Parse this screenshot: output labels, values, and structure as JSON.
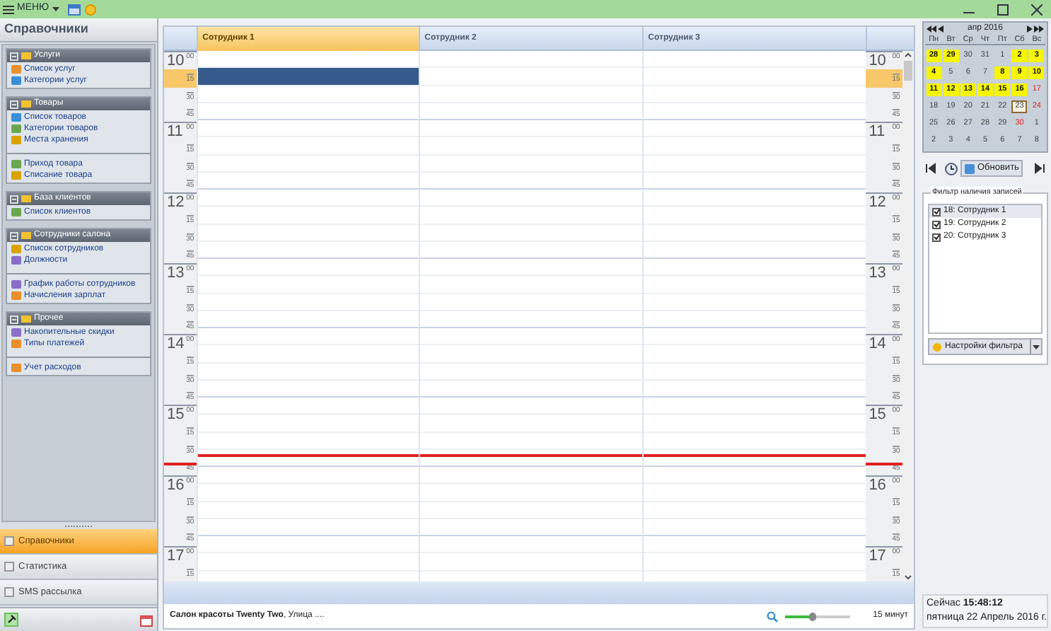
{
  "topbar": {
    "menu_label": "МЕНЮ"
  },
  "sidebar": {
    "title": "Справочники",
    "groups": [
      {
        "title": "Услуги",
        "sections": [
          [
            "Список услуг",
            "Категории услуг"
          ]
        ]
      },
      {
        "title": "Товары",
        "sections": [
          [
            "Список товаров",
            "Категории товаров",
            "Места хранения"
          ],
          [
            "Приход товара",
            "Списание товара"
          ]
        ]
      },
      {
        "title": "База клиентов",
        "sections": [
          [
            "Список клиентов"
          ]
        ]
      },
      {
        "title": "Сотрудники салона",
        "sections": [
          [
            "Список сотрудников",
            "Должности"
          ],
          [
            "График работы сотрудников",
            "Начисления зарплат"
          ]
        ]
      },
      {
        "title": "Прочее",
        "sections": [
          [
            "Накопительные скидки",
            "Типы платежей"
          ],
          [
            "Учет расходов"
          ]
        ]
      }
    ],
    "nav": [
      {
        "label": "Справочники",
        "selected": true
      },
      {
        "label": "Статистика",
        "selected": false
      },
      {
        "label": "SMS рассылка",
        "selected": false
      }
    ]
  },
  "scheduler": {
    "columns": [
      {
        "label": "Сотрудник 1",
        "selected": true
      },
      {
        "label": "Сотрудник 2",
        "selected": false
      },
      {
        "label": "Сотрудник 3",
        "selected": false
      }
    ],
    "time_axis_left": [
      {
        "hour": "10",
        "slots": [
          {
            "label": "00",
            "selected": false,
            "current_time": false
          },
          {
            "label": "15",
            "selected": true,
            "current_time": false
          },
          {
            "label": "30",
            "selected": false,
            "current_time": false
          },
          {
            "label": "45",
            "selected": false,
            "current_time": false
          }
        ]
      },
      {
        "hour": "11",
        "slots": [
          {
            "label": "00",
            "selected": false,
            "current_time": false
          },
          {
            "label": "15",
            "selected": false,
            "current_time": false
          },
          {
            "label": "30",
            "selected": false,
            "current_time": false
          },
          {
            "label": "45",
            "selected": false,
            "current_time": false
          }
        ]
      },
      {
        "hour": "12",
        "slots": [
          {
            "label": "00",
            "selected": false,
            "current_time": false
          },
          {
            "label": "15",
            "selected": false,
            "current_time": false
          },
          {
            "label": "30",
            "selected": false,
            "current_time": false
          },
          {
            "label": "45",
            "selected": false,
            "current_time": false
          }
        ]
      },
      {
        "hour": "13",
        "slots": [
          {
            "label": "00",
            "selected": false,
            "current_time": false
          },
          {
            "label": "15",
            "selected": false,
            "current_time": false
          },
          {
            "label": "30",
            "selected": false,
            "current_time": false
          },
          {
            "label": "45",
            "selected": false,
            "current_time": false
          }
        ]
      },
      {
        "hour": "14",
        "slots": [
          {
            "label": "00",
            "selected": false,
            "current_time": false
          },
          {
            "label": "15",
            "selected": false,
            "current_time": false
          },
          {
            "label": "30",
            "selected": false,
            "current_time": false
          },
          {
            "label": "45",
            "selected": false,
            "current_time": false
          }
        ]
      },
      {
        "hour": "15",
        "slots": [
          {
            "label": "00",
            "selected": false,
            "current_time": false
          },
          {
            "label": "15",
            "selected": false,
            "current_time": false
          },
          {
            "label": "30",
            "selected": false,
            "current_time": false
          },
          {
            "label": "45",
            "selected": false,
            "current_time": true
          }
        ]
      },
      {
        "hour": "16",
        "slots": [
          {
            "label": "00",
            "selected": false,
            "current_time": false
          },
          {
            "label": "15",
            "selected": false,
            "current_time": false
          },
          {
            "label": "30",
            "selected": false,
            "current_time": false
          },
          {
            "label": "45",
            "selected": false,
            "current_time": false
          }
        ]
      },
      {
        "hour": "17",
        "slots": [
          {
            "label": "00",
            "selected": false,
            "current_time": false
          },
          {
            "label": "15",
            "selected": false,
            "current_time": false
          }
        ]
      }
    ],
    "time_axis_right": [
      {
        "hour": "10",
        "minutes": [
          "00",
          "15",
          "30",
          "45"
        ]
      },
      {
        "hour": "11",
        "minutes": [
          "00",
          "15",
          "30",
          "45"
        ]
      },
      {
        "hour": "12",
        "minutes": [
          "00",
          "15",
          "30",
          "45"
        ]
      },
      {
        "hour": "13",
        "minutes": [
          "00",
          "15",
          "30",
          "45"
        ]
      },
      {
        "hour": "14",
        "minutes": [
          "00",
          "15",
          "30",
          "45"
        ]
      },
      {
        "hour": "15",
        "minutes": [
          "00",
          "15",
          "30",
          "45"
        ]
      },
      {
        "hour": "16",
        "minutes": [
          "00",
          "15",
          "30",
          "45"
        ]
      },
      {
        "hour": "17",
        "minutes": [
          "00",
          "15"
        ]
      }
    ],
    "status_text": "**Салон красоты Twenty Two**, Улица ....",
    "zoom": {
      "level": 0.4
    },
    "zoom_label": "15 минут"
  },
  "calendar": {
    "month": "апр 2016",
    "weekdays": [
      "Пн",
      "Вт",
      "Ср",
      "Чт",
      "Пт",
      "Сб",
      "Вс"
    ],
    "days": [
      {
        "text": "28",
        "highlighted": true,
        "red": false,
        "today": false
      },
      {
        "text": "29",
        "highlighted": true,
        "red": false,
        "today": false
      },
      {
        "text": "30",
        "highlighted": false,
        "red": false,
        "today": false
      },
      {
        "text": "31",
        "highlighted": false,
        "red": false,
        "today": false
      },
      {
        "text": "1",
        "highlighted": false,
        "red": false,
        "today": false
      },
      {
        "text": "2",
        "highlighted": true,
        "red": false,
        "today": false
      },
      {
        "text": "3",
        "highlighted": true,
        "red": false,
        "today": false
      },
      {
        "text": "4",
        "highlighted": true,
        "red": false,
        "today": false
      },
      {
        "text": "5",
        "highlighted": false,
        "red": false,
        "today": false
      },
      {
        "text": "6",
        "highlighted": false,
        "red": false,
        "today": false
      },
      {
        "text": "7",
        "highlighted": false,
        "red": false,
        "today": false
      },
      {
        "text": "8",
        "highlighted": true,
        "red": false,
        "today": false
      },
      {
        "text": "9",
        "highlighted": true,
        "red": false,
        "today": false
      },
      {
        "text": "10",
        "highlighted": true,
        "red": false,
        "today": false
      },
      {
        "text": "11",
        "highlighted": true,
        "red": false,
        "today": false
      },
      {
        "text": "12",
        "highlighted": true,
        "red": false,
        "today": false
      },
      {
        "text": "13",
        "highlighted": true,
        "red": false,
        "today": false
      },
      {
        "text": "14",
        "highlighted": true,
        "red": false,
        "today": false
      },
      {
        "text": "15",
        "highlighted": true,
        "red": false,
        "today": false
      },
      {
        "text": "16",
        "highlighted": true,
        "red": false,
        "today": false
      },
      {
        "text": "17",
        "highlighted": false,
        "red": true,
        "today": false
      },
      {
        "text": "18",
        "highlighted": false,
        "red": false,
        "today": false
      },
      {
        "text": "19",
        "highlighted": false,
        "red": false,
        "today": false
      },
      {
        "text": "20",
        "highlighted": false,
        "red": false,
        "today": false
      },
      {
        "text": "21",
        "highlighted": false,
        "red": false,
        "today": false
      },
      {
        "text": "22",
        "highlighted": false,
        "red": false,
        "today": false
      },
      {
        "text": "23",
        "highlighted": false,
        "red": false,
        "today": true
      },
      {
        "text": "24",
        "highlighted": false,
        "red": true,
        "today": false
      },
      {
        "text": "25",
        "highlighted": false,
        "red": false,
        "today": false
      },
      {
        "text": "26",
        "highlighted": false,
        "red": false,
        "today": false
      },
      {
        "text": "27",
        "highlighted": false,
        "red": false,
        "today": false
      },
      {
        "text": "28",
        "highlighted": false,
        "red": false,
        "today": false
      },
      {
        "text": "29",
        "highlighted": false,
        "red": false,
        "today": false
      },
      {
        "text": "30",
        "highlighted": false,
        "red": true,
        "today": false
      },
      {
        "text": "1",
        "highlighted": false,
        "red": false,
        "today": false
      },
      {
        "text": "2",
        "highlighted": false,
        "red": false,
        "today": false
      },
      {
        "text": "3",
        "highlighted": false,
        "red": false,
        "today": false
      },
      {
        "text": "4",
        "highlighted": false,
        "red": false,
        "today": false
      },
      {
        "text": "5",
        "highlighted": false,
        "red": false,
        "today": false
      },
      {
        "text": "6",
        "highlighted": false,
        "red": false,
        "today": false
      },
      {
        "text": "7",
        "highlighted": false,
        "red": false,
        "today": false
      },
      {
        "text": "8",
        "highlighted": false,
        "red": false,
        "today": false
      }
    ],
    "refresh_label": "Обновить"
  },
  "filter": {
    "title": "Фильтр наличия записей",
    "items": [
      {
        "label": "18: Сотрудник 1",
        "checked": true,
        "selected": true
      },
      {
        "label": "19: Сотрудник 2",
        "checked": true,
        "selected": false
      },
      {
        "label": "20: Сотрудник 3",
        "checked": true,
        "selected": false
      }
    ],
    "settings_label": "Настройки фильтра"
  },
  "clock": {
    "now": "Сейчас **15:48:12**",
    "date": "пятница 22 Апрель 2016 г."
  }
}
